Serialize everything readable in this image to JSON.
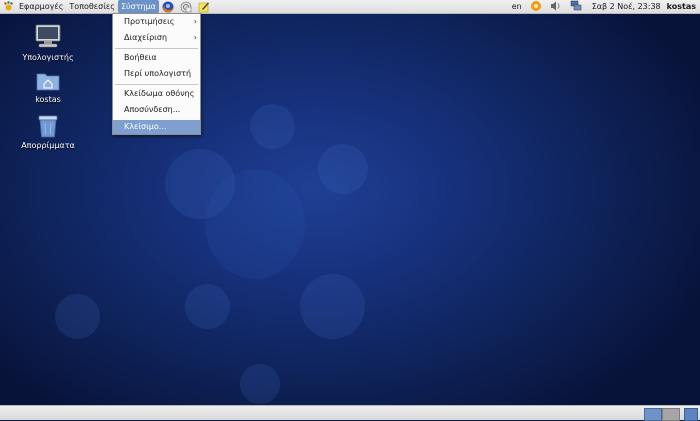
{
  "top_panel": {
    "menus": [
      {
        "label": "Εφαρμογές"
      },
      {
        "label": "Τοποθεσίες"
      },
      {
        "label": "Σύστημα"
      }
    ],
    "launchers": [
      "firefox-icon",
      "evolution-icon",
      "notes-icon"
    ],
    "tray": {
      "language": "en",
      "icons": [
        "updates-icon",
        "volume-icon",
        "network-icon"
      ],
      "clock": "Σαβ  2 Νοέ, 23:38",
      "user": "kostas"
    }
  },
  "desktop": {
    "icons": [
      {
        "label": "Υπολογιστής",
        "icon": "computer-icon"
      },
      {
        "label": "kostas",
        "icon": "home-folder-icon"
      },
      {
        "label": "Απορρίμματα",
        "icon": "trash-icon"
      }
    ]
  },
  "system_menu": {
    "items": [
      {
        "label": "Προτιμήσεις",
        "submenu": true
      },
      {
        "label": "Διαχείριση",
        "submenu": true
      },
      {
        "label": "Βοήθεια",
        "submenu": false
      },
      {
        "label": "Περί υπολογιστή",
        "submenu": false
      },
      {
        "label": "Κλείδωμα οθόνης",
        "submenu": false
      },
      {
        "label": "Αποσύνδεση...",
        "submenu": false
      },
      {
        "label": "Κλείσιμο...",
        "submenu": false,
        "highlighted": true
      }
    ],
    "submenu_arrow": "›"
  },
  "bottom_panel": {
    "workspaces": [
      "workspace-1",
      "workspace-2"
    ],
    "active_workspace": 1
  },
  "colors": {
    "menu_highlight": "#7f9fcf",
    "active_menu": "#6b93c8",
    "desktop_blue": "#16307a"
  }
}
